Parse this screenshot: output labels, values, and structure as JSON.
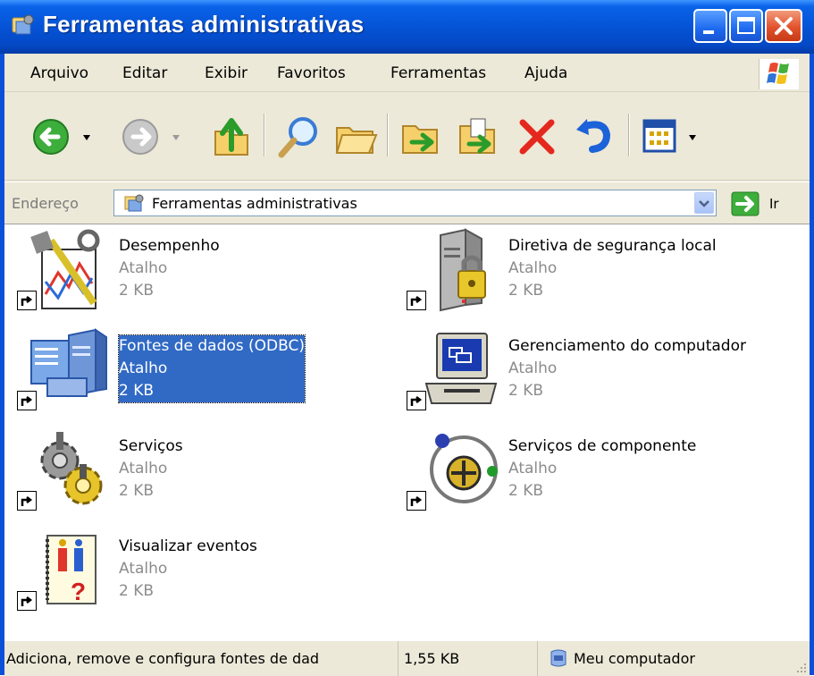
{
  "window": {
    "title": "Ferramentas administrativas",
    "buttons": {
      "minimize": "minimize-icon",
      "maximize": "maximize-icon",
      "close": "close-icon"
    }
  },
  "menu": {
    "items": [
      {
        "label": "Arquivo"
      },
      {
        "label": "Editar"
      },
      {
        "label": "Exibir"
      },
      {
        "label": "Favoritos"
      },
      {
        "label": "Ferramentas"
      },
      {
        "label": "Ajuda"
      }
    ]
  },
  "toolbar": {
    "icons": [
      "back-icon",
      "forward-icon",
      "up-folder-icon",
      "search-icon",
      "folders-icon",
      "move-to-icon",
      "copy-to-icon",
      "delete-icon",
      "undo-icon",
      "views-icon"
    ]
  },
  "address": {
    "label": "Endereço",
    "value": "Ferramentas administrativas",
    "go_label": "Ir"
  },
  "items": [
    {
      "name": "Desempenho",
      "type": "Atalho",
      "size": "2 KB",
      "icon": "performance-icon"
    },
    {
      "name": "Diretiva de segurança local",
      "type": "Atalho",
      "size": "2 KB",
      "icon": "security-policy-icon"
    },
    {
      "name": "Fontes de dados (ODBC)",
      "type": "Atalho",
      "size": "2 KB",
      "icon": "odbc-icon",
      "selected": true
    },
    {
      "name": "Gerenciamento do computador",
      "type": "Atalho",
      "size": "2 KB",
      "icon": "computer-management-icon"
    },
    {
      "name": "Serviços",
      "type": "Atalho",
      "size": "2 KB",
      "icon": "services-icon"
    },
    {
      "name": "Serviços de componente",
      "type": "Atalho",
      "size": "2 KB",
      "icon": "component-services-icon"
    },
    {
      "name": "Visualizar eventos",
      "type": "Atalho",
      "size": "2 KB",
      "icon": "event-viewer-icon"
    }
  ],
  "status": {
    "description": "Adiciona, remove e configura fontes de dad",
    "size": "1,55 KB",
    "location": "Meu computador"
  },
  "colors": {
    "titlebar": "#0553d6",
    "selection": "#316ac5",
    "chrome": "#ece9d8"
  }
}
